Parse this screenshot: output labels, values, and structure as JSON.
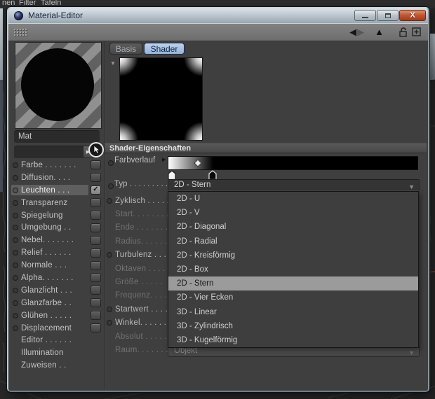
{
  "app_menu": {
    "items": [
      "nen",
      "Filter",
      "Tafeln"
    ]
  },
  "window": {
    "title": "Material-Editor",
    "close_glyph": "X"
  },
  "toolbar": {
    "back_glyph": "◀",
    "forward_glyph": "▶",
    "up_glyph": "▲"
  },
  "ui": {
    "check_glyph": "✓",
    "caret_down_glyph": "▼",
    "caret_right_glyph": "▶",
    "expander_down_glyph": "▼"
  },
  "left_panel": {
    "material_name_value": "Mat",
    "shader_link_value": "",
    "channels": [
      {
        "label": "Farbe . . . . . . .",
        "type": "channel",
        "checked": false,
        "selected": false
      },
      {
        "label": "Diffusion. . . .",
        "type": "channel",
        "checked": false,
        "selected": false
      },
      {
        "label": "Leuchten . . .",
        "type": "channel",
        "checked": true,
        "selected": true
      },
      {
        "label": "Transparenz",
        "type": "channel",
        "checked": false,
        "selected": false
      },
      {
        "label": "Spiegelung",
        "type": "channel",
        "checked": false,
        "selected": false
      },
      {
        "label": "Umgebung . .",
        "type": "channel",
        "checked": false,
        "selected": false
      },
      {
        "label": "Nebel. . . . . . .",
        "type": "channel",
        "checked": false,
        "selected": false
      },
      {
        "label": "Relief . . . . . .",
        "type": "channel",
        "checked": false,
        "selected": false
      },
      {
        "label": "Normale  . . .",
        "type": "channel",
        "checked": false,
        "selected": false
      },
      {
        "label": "Alpha. . . . . . .",
        "type": "channel",
        "checked": false,
        "selected": false
      },
      {
        "label": "Glanzlicht . . .",
        "type": "channel",
        "checked": false,
        "selected": false
      },
      {
        "label": "Glanzfarbe . .",
        "type": "channel",
        "checked": false,
        "selected": false
      },
      {
        "label": "Glühen . . . . .",
        "type": "channel",
        "checked": false,
        "selected": false
      },
      {
        "label": "Displacement",
        "type": "channel",
        "checked": false,
        "selected": false
      },
      {
        "label": "Editor . . . . . .",
        "type": "plain"
      },
      {
        "label": "Illumination",
        "type": "plain"
      },
      {
        "label": "Zuweisen . .",
        "type": "plain"
      }
    ]
  },
  "right_panel": {
    "tabs": [
      {
        "label": "Basis",
        "active": false
      },
      {
        "label": "Shader",
        "active": true
      }
    ],
    "section_header": "Shader-Eigenschaften",
    "gradient_row": {
      "label": "Farbverlauf",
      "stops": [
        {
          "color": "#ffffff",
          "pos": 0
        },
        {
          "color": "#000000",
          "pos": 0.18
        }
      ],
      "knots": [
        {
          "color": "#f2f2f2",
          "pos": 0.008
        },
        {
          "color": "#0a0a0a",
          "pos": 0.18
        }
      ],
      "midpoint": 0.12
    },
    "typ_row": {
      "label": "Typ . . . . . . . . .",
      "value": "2D - Stern"
    },
    "properties": [
      {
        "label": "Zyklisch . . . . .",
        "enabled": true,
        "circle": true
      },
      {
        "label": "Start. . . . . . . .",
        "enabled": false,
        "circle": false
      },
      {
        "label": "Ende . . . . . . .",
        "enabled": false,
        "circle": false
      },
      {
        "label": "Radius. . . . . .",
        "enabled": false,
        "circle": false
      },
      {
        "label": "Turbulenz . . .",
        "enabled": true,
        "circle": true
      },
      {
        "label": "Oktaven  . . . .",
        "enabled": false,
        "circle": false
      },
      {
        "label": "Größe  . . . . .",
        "enabled": false,
        "circle": false
      },
      {
        "label": "Frequenz. . . .",
        "enabled": false,
        "circle": false
      },
      {
        "label": "Startwert . . . .",
        "enabled": true,
        "circle": true
      },
      {
        "label": "Winkel. . . . . .",
        "enabled": true,
        "circle": true
      },
      {
        "label": "Absolut . . . . .",
        "enabled": false,
        "circle": false
      },
      {
        "label": "Raum. . . . . . .",
        "enabled": false,
        "circle": false
      }
    ],
    "raum_dropdown": {
      "value": "Objekt"
    },
    "type_dropdown": {
      "options": [
        "2D - U",
        "2D - V",
        "2D - Diagonal",
        "2D - Radial",
        "2D - Kreisförmig",
        "2D - Box",
        "2D - Stern",
        "2D - Vier Ecken",
        "3D - Linear",
        "3D - Zylindrisch",
        "3D - Kugelförmig"
      ],
      "selected_index": 6
    }
  },
  "colors": {
    "active_tab": "#9db8dc",
    "selection_highlight": "#9b9b9b",
    "close_button": "#c3532c",
    "panel_background": "#3f3f3f",
    "titlebar": "#b6c1ca"
  }
}
